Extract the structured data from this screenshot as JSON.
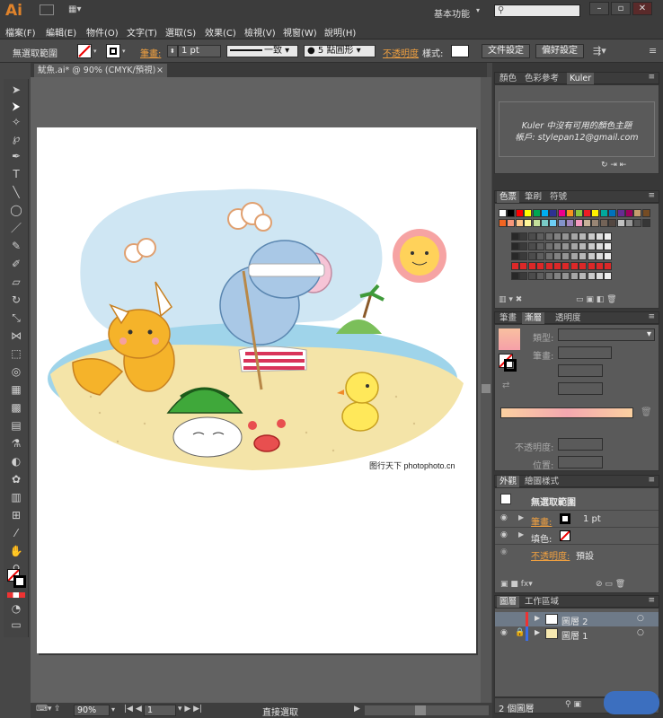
{
  "app": {
    "logo": "Ai",
    "workspace": "基本功能",
    "search_placeholder": ""
  },
  "menu": [
    "檔案(F)",
    "編輯(E)",
    "物件(O)",
    "文字(T)",
    "選取(S)",
    "效果(C)",
    "檢視(V)",
    "視窗(W)",
    "說明(H)"
  ],
  "control": {
    "selection": "無選取範圍",
    "stroke_label": "筆畫:",
    "stroke_value": "1 pt",
    "profile": "一致",
    "brush": "5 點圓形",
    "opacity_label": "不透明度",
    "style_label": "樣式:",
    "doc_setup": "文件設定",
    "prefs": "偏好設定"
  },
  "document": {
    "tab": "魷魚.ai* @ 90% (CMYK/預視)",
    "credit": "图行天下 photophoto.cn"
  },
  "status": {
    "zoom": "90%",
    "page": "1",
    "tool": "直接選取"
  },
  "panels": {
    "kuler": {
      "tabs": [
        "顏色",
        "色彩參考",
        "Kuler"
      ],
      "message": "Kuler 中沒有可用的顏色主題",
      "account": "帳戶: stylepan12@gmail.com"
    },
    "swatches": {
      "tabs": [
        "色票",
        "筆刷",
        "符號"
      ]
    },
    "gradient": {
      "tabs": [
        "筆畫",
        "漸層",
        "透明度"
      ],
      "type_label": "類型:",
      "stroke_label": "筆畫:",
      "opacity_label": "不透明度:",
      "location_label": "位置:"
    },
    "appearance": {
      "tabs": [
        "外觀",
        "繪圖樣式"
      ],
      "title": "無選取範圍",
      "stroke_label": "筆畫:",
      "stroke_value": "1 pt",
      "fill_label": "填色:",
      "opacity_label": "不透明度:",
      "opacity_value": "預設"
    },
    "layers": {
      "tabs": [
        "圖層",
        "工作區域"
      ],
      "rows": [
        {
          "name": "圖層 2"
        },
        {
          "name": "圖層 1"
        }
      ],
      "footer": "2 個圖層"
    }
  },
  "colors": {
    "accent": "#e0832b",
    "swatch_rows": [
      [
        "#ffffff",
        "#000000",
        "#ff0000",
        "#ffff00",
        "#00a651",
        "#00aeef",
        "#2e3192",
        "#ec008c",
        "#f7941d",
        "#8dc63f",
        "#ed1c24",
        "#fff200",
        "#00a99d",
        "#0072bc",
        "#662d91",
        "#9e005d",
        "#c69c6d",
        "#754c24"
      ],
      [
        "#f26522",
        "#f7977a",
        "#fdc689",
        "#fff799",
        "#c4df9b",
        "#7accc8",
        "#6dcff6",
        "#8393ca",
        "#a186be",
        "#f49ac1",
        "#c7b299",
        "#998675",
        "#736357",
        "#534741",
        "#c2c2c2",
        "#959595",
        "#555555",
        "#363636"
      ]
    ]
  }
}
